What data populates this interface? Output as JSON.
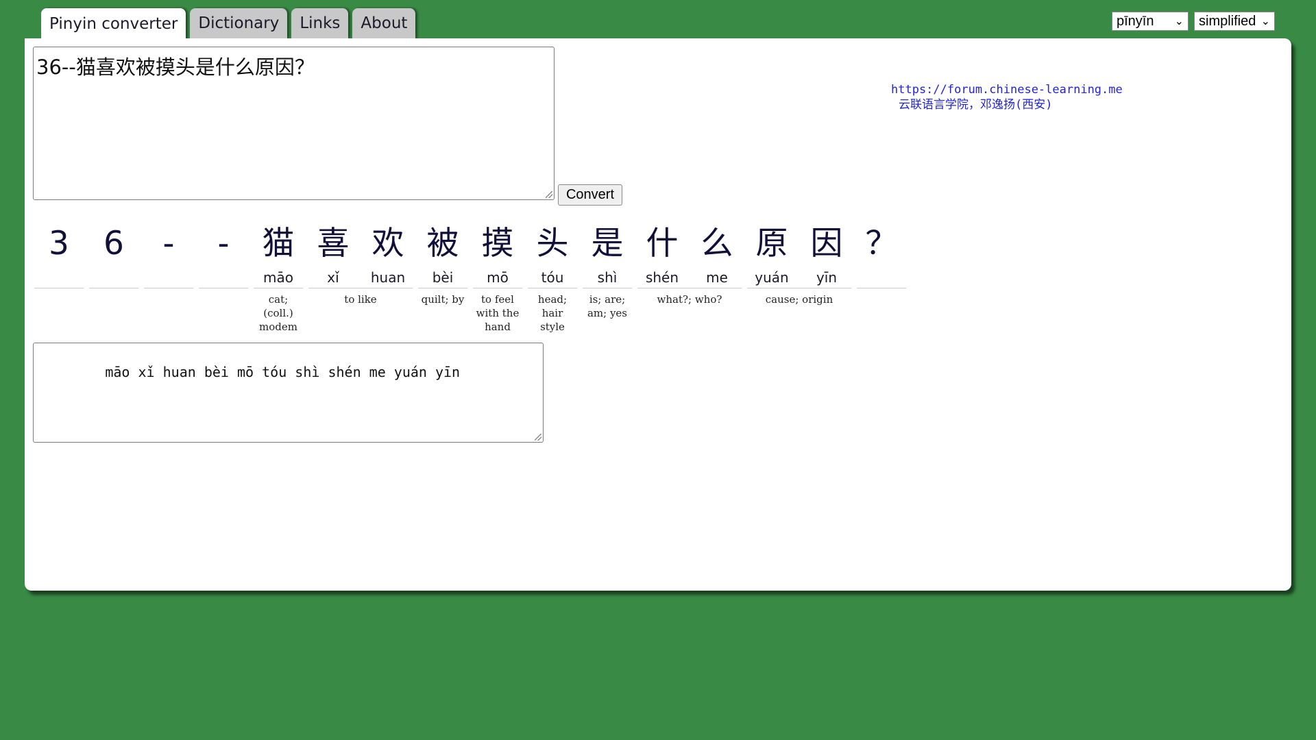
{
  "tabs": [
    {
      "label": "Pinyin converter",
      "active": true
    },
    {
      "label": "Dictionary",
      "active": false
    },
    {
      "label": "Links",
      "active": false
    },
    {
      "label": "About",
      "active": false
    }
  ],
  "selects": {
    "romanization": "pīnyīn",
    "script": "simplified"
  },
  "input": {
    "text": "36--猫喜欢被摸头是什么原因？"
  },
  "convert_label": "Convert",
  "credit": {
    "url": "https://forum.chinese-learning.me",
    "org": "云联语言学院，邓逸扬(西安)"
  },
  "words": [
    {
      "chars": [
        {
          "hz": "3",
          "py": ""
        }
      ],
      "gloss": ""
    },
    {
      "chars": [
        {
          "hz": "6",
          "py": ""
        }
      ],
      "gloss": ""
    },
    {
      "chars": [
        {
          "hz": "-",
          "py": ""
        }
      ],
      "gloss": ""
    },
    {
      "chars": [
        {
          "hz": "-",
          "py": ""
        }
      ],
      "gloss": ""
    },
    {
      "chars": [
        {
          "hz": "猫",
          "py": "māo"
        }
      ],
      "gloss": "cat; (coll.) modem"
    },
    {
      "chars": [
        {
          "hz": "喜",
          "py": "xǐ"
        },
        {
          "hz": "欢",
          "py": "huan"
        }
      ],
      "gloss": "to like"
    },
    {
      "chars": [
        {
          "hz": "被",
          "py": "bèi"
        }
      ],
      "gloss": "quilt; by"
    },
    {
      "chars": [
        {
          "hz": "摸",
          "py": "mō"
        }
      ],
      "gloss": "to feel with the hand"
    },
    {
      "chars": [
        {
          "hz": "头",
          "py": "tóu"
        }
      ],
      "gloss": "head; hair style"
    },
    {
      "chars": [
        {
          "hz": "是",
          "py": "shì"
        }
      ],
      "gloss": "is; are; am; yes"
    },
    {
      "chars": [
        {
          "hz": "什",
          "py": "shén"
        },
        {
          "hz": "么",
          "py": "me"
        }
      ],
      "gloss": "what?; who?"
    },
    {
      "chars": [
        {
          "hz": "原",
          "py": "yuán"
        },
        {
          "hz": "因",
          "py": "yīn"
        }
      ],
      "gloss": "cause; origin"
    },
    {
      "chars": [
        {
          "hz": "？",
          "py": ""
        }
      ],
      "gloss": ""
    }
  ],
  "output": {
    "text": "    māo xǐ huan bèi mō tóu shì shén me yuán yīn"
  }
}
